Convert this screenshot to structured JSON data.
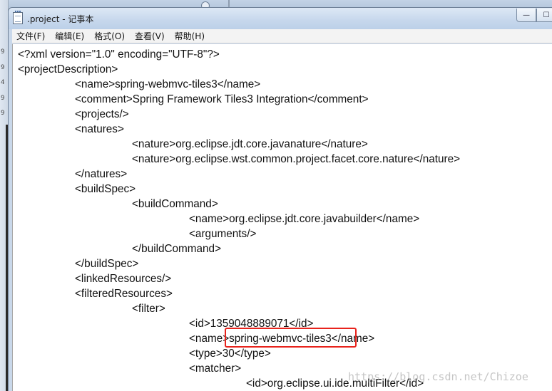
{
  "window": {
    "title": ".project - 记事本",
    "controls": {
      "minimize": "—",
      "maximize": "☐"
    }
  },
  "menu": [
    {
      "label": "文件(F)"
    },
    {
      "label": "编辑(E)"
    },
    {
      "label": "格式(O)"
    },
    {
      "label": "查看(V)"
    },
    {
      "label": "帮助(H)"
    }
  ],
  "editor": {
    "lines": [
      "<?xml version=\"1.0\" encoding=\"UTF-8\"?>",
      "<projectDescription>",
      "\t<name>spring-webmvc-tiles3</name>",
      "\t<comment>Spring Framework Tiles3 Integration</comment>",
      "\t<projects/>",
      "\t<natures>",
      "\t\t<nature>org.eclipse.jdt.core.javanature</nature>",
      "\t\t<nature>org.eclipse.wst.common.project.facet.core.nature</nature>",
      "\t</natures>",
      "\t<buildSpec>",
      "\t\t<buildCommand>",
      "\t\t\t<name>org.eclipse.jdt.core.javabuilder</name>",
      "\t\t\t<arguments/>",
      "\t\t</buildCommand>",
      "\t</buildSpec>",
      "\t<linkedResources/>",
      "\t<filteredResources>",
      "\t\t<filter>",
      "\t\t\t<id>1359048889071</id>",
      "\t\t\t<name>spring-webmvc-tiles3</name>",
      "\t\t\t<type>30</type>",
      "\t\t\t<matcher>",
      "\t\t\t\t<id>org.eclipse.ui.ide.multiFilter</id>"
    ]
  },
  "background": {
    "digits": [
      "9",
      "9",
      "4",
      "9",
      "9"
    ]
  },
  "watermark": "https://blog.csdn.net/Chizoe",
  "colors": {
    "highlight": "#e8231c",
    "titlebar": "#c6d7ec"
  }
}
